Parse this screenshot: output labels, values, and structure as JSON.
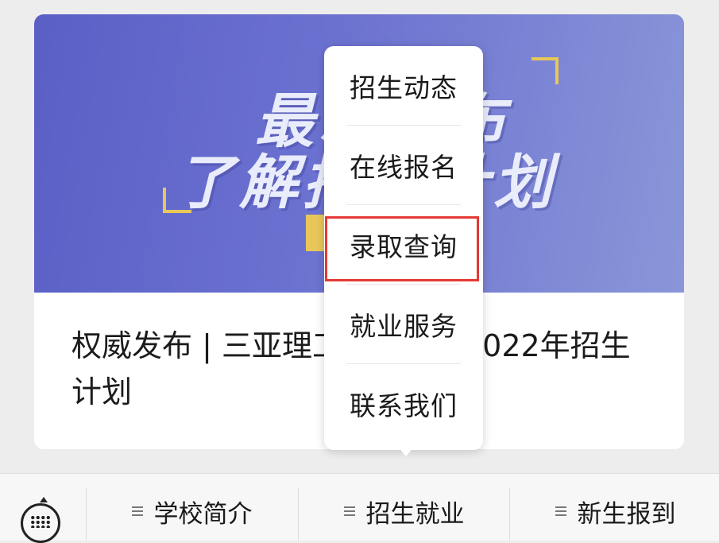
{
  "article": {
    "banner_line1": "最新发布",
    "banner_line2": "了解招生计划",
    "title": "权威发布 | 三亚理工职业学院2022年招生计划"
  },
  "popup_menu": {
    "items": [
      "招生动态",
      "在线报名",
      "录取查询",
      "就业服务",
      "联系我们"
    ],
    "highlighted_item": "录取查询",
    "highlight_color": "#e53935"
  },
  "bottom_menu": {
    "keyboard_icon": "keyboard-icon",
    "items": [
      "学校简介",
      "招生就业",
      "新生报到"
    ],
    "menu_icon": "list-icon"
  },
  "colors": {
    "banner_start": "#5a5fc6",
    "banner_end": "#8a96d8",
    "accent_yellow": "#e8c75a"
  }
}
